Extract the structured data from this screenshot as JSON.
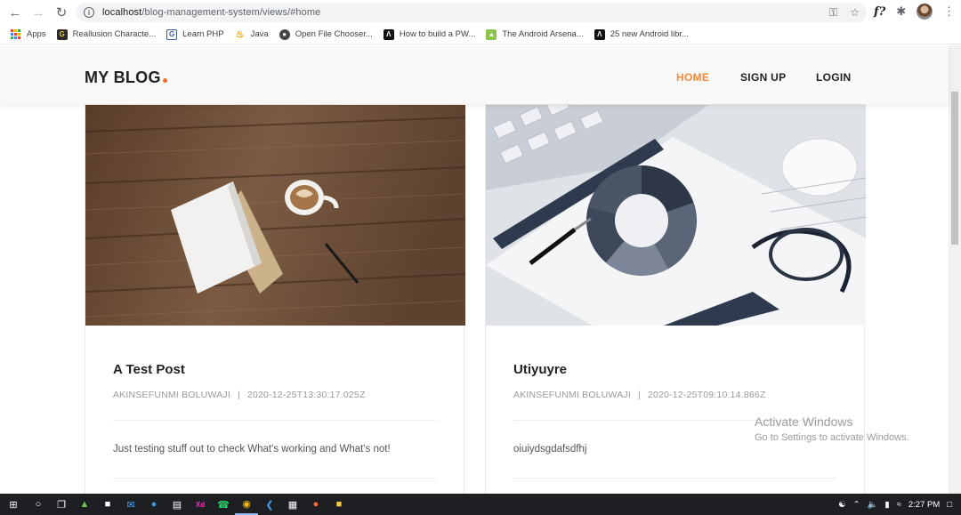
{
  "browser": {
    "url_host": "localhost",
    "url_path": "/blog-management-system/views/#home",
    "bookmarks": [
      {
        "label": "Apps",
        "icon": "apps-grid-icon"
      },
      {
        "label": "Reallusion Characte...",
        "icon": "reallusion-icon",
        "color": "#2b2b2b"
      },
      {
        "label": "Learn PHP",
        "icon": "learn-php-icon",
        "color": "#3b5998"
      },
      {
        "label": "Java",
        "icon": "java-icon",
        "color": "#f0a30a"
      },
      {
        "label": "Open File Chooser...",
        "icon": "github-icon",
        "color": "#444444"
      },
      {
        "label": "How to build a PW...",
        "icon": "medium-icon",
        "color": "#111111"
      },
      {
        "label": "The Android Arsena...",
        "icon": "android-arsenal-icon",
        "color": "#8bc34a"
      },
      {
        "label": "25 new Android libr...",
        "icon": "medium-icon",
        "color": "#111111"
      }
    ]
  },
  "site": {
    "logo": "MY BLOG",
    "accent": "#f26d21",
    "nav": [
      {
        "label": "HOME",
        "active": true
      },
      {
        "label": "SIGN UP",
        "active": false
      },
      {
        "label": "LOGIN",
        "active": false
      }
    ]
  },
  "posts": [
    {
      "title": "A Test Post",
      "author": "AKINSEFUNMI BOLUWAJI",
      "date": "2020-12-25T13:30:17.025Z",
      "excerpt": "Just testing stuff out to check What's working and What's not!",
      "image": "coffee-desk-photo"
    },
    {
      "title": "Utiyuyre",
      "author": "AKINSEFUNMI BOLUWAJI",
      "date": "2020-12-25T09:10:14.866Z",
      "excerpt": "oiuiydsgdafsdfhj",
      "image": "financial-charts-photo"
    }
  ],
  "watermark": {
    "line1": "Activate Windows",
    "line2": "Go to Settings to activate Windows."
  },
  "taskbar": {
    "time": "2:27 PM"
  }
}
